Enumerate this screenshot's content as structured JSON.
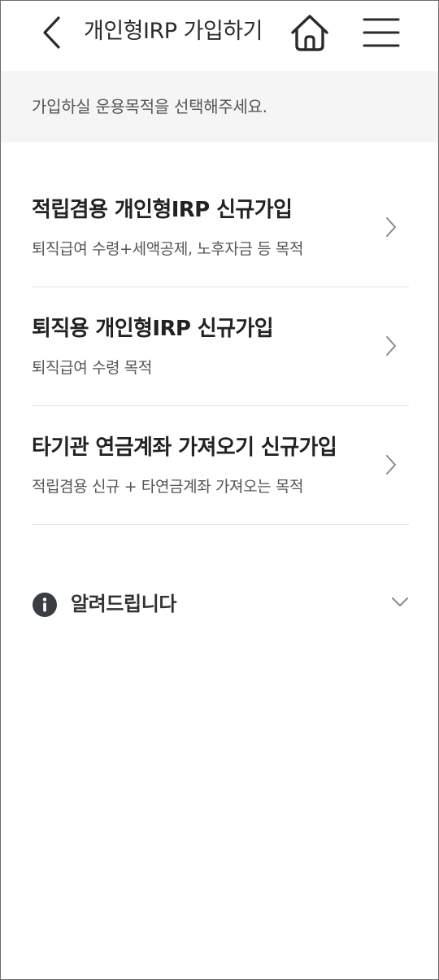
{
  "header": {
    "title": "개인형IRP 가입하기",
    "back_icon": "chevron-left-icon",
    "home_icon": "home-icon",
    "menu_icon": "hamburger-menu-icon"
  },
  "guide": {
    "text": "가입하실 운용목적을 선택해주세요."
  },
  "options": [
    {
      "title": "적립겸용 개인형IRP 신규가입",
      "description": "퇴직급여 수령+세액공제, 노후자금 등 목적"
    },
    {
      "title": "퇴직용 개인형IRP 신규가입",
      "description": "퇴직급여 수령 목적"
    },
    {
      "title": "타기관 연금계좌 가져오기 신규가입",
      "description": "적립겸용 신규 + 타연금계좌 가져오는 목적"
    }
  ],
  "notice": {
    "label": "알려드립니다",
    "icon": "info-icon",
    "expanded": false
  },
  "colors": {
    "text_primary": "#222222",
    "text_secondary": "#555555",
    "guide_background": "#f5f5f5",
    "divider": "#e2e2e2",
    "icon_dark": "#3a3d42"
  }
}
